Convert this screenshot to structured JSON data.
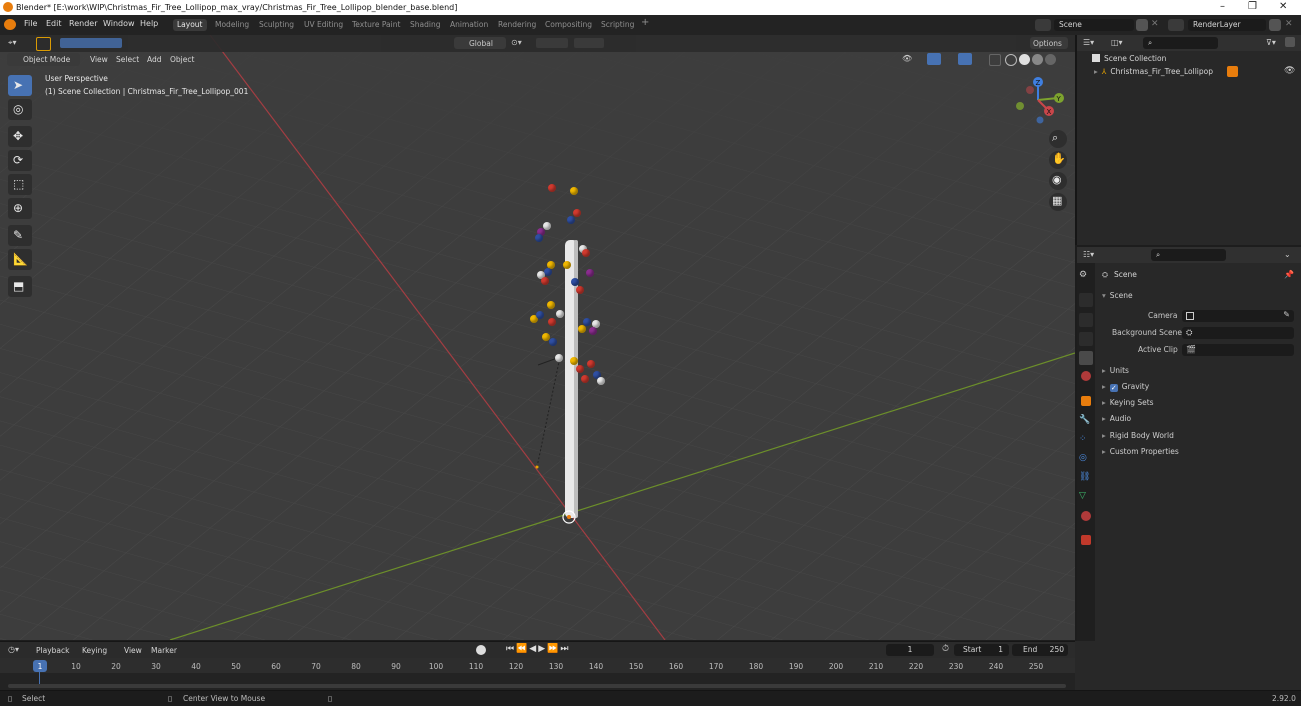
{
  "window": {
    "title": "Blender* [E:\\work\\WIP\\Christmas_Fir_Tree_Lollipop_max_vray/Christmas_Fir_Tree_Lollipop_blender_base.blend]",
    "minimize": "–",
    "restore": "❐",
    "close": "✕"
  },
  "menu": [
    "File",
    "Edit",
    "Render",
    "Window",
    "Help"
  ],
  "workspaces": [
    "Layout",
    "Modeling",
    "Sculpting",
    "UV Editing",
    "Texture Paint",
    "Shading",
    "Animation",
    "Rendering",
    "Compositing",
    "Scripting",
    "+"
  ],
  "scene_field": "Scene",
  "render_layer_field": "RenderLayer",
  "viewport_header": {
    "transform_orientation": "Global",
    "options": "Options"
  },
  "viewport_menu": {
    "mode": "Object Mode",
    "items": [
      "View",
      "Select",
      "Add",
      "Object"
    ]
  },
  "viewport_overlay": {
    "perspective": "User Perspective",
    "collection_path": "(1) Scene Collection | Christmas_Fir_Tree_Lollipop_001"
  },
  "gizmo": {
    "z": "Z",
    "y": "Y",
    "x": "X"
  },
  "outliner": {
    "root": "Scene Collection",
    "item": "Christmas_Fir_Tree_Lollipop"
  },
  "properties": {
    "context": "Scene",
    "section": "Scene",
    "camera_label": "Camera",
    "background_label": "Background Scene",
    "clip_label": "Active Clip",
    "sections": [
      "Units",
      "Gravity",
      "Keying Sets",
      "Audio",
      "Rigid Body World",
      "Custom Properties"
    ],
    "gravity_checked": true
  },
  "timeline": {
    "menus": [
      "Playback",
      "Keying",
      "View",
      "Marker"
    ],
    "current_frame": "1",
    "start_label": "Start",
    "start_value": "1",
    "end_label": "End",
    "end_value": "250",
    "ruler": [
      "1",
      "10",
      "20",
      "30",
      "40",
      "50",
      "60",
      "70",
      "80",
      "90",
      "100",
      "110",
      "120",
      "130",
      "140",
      "150",
      "160",
      "170",
      "180",
      "190",
      "200",
      "210",
      "220",
      "230",
      "240",
      "250"
    ]
  },
  "statusbar": {
    "select": "Select",
    "center_view": "Center View to Mouse",
    "version": "2.92.0"
  },
  "colors": {
    "accent": "#4772b3",
    "x_axis": "#c9464a",
    "y_axis": "#7da32e",
    "z_axis": "#3f7fe0",
    "orange": "#e87d0d"
  }
}
